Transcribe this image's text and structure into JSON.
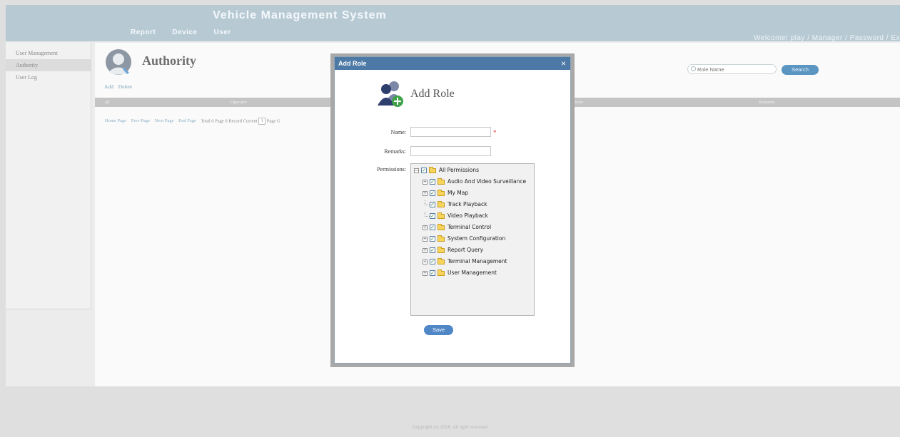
{
  "header": {
    "app_title": "Vehicle Management System",
    "nav": [
      "Report",
      "Device",
      "User"
    ],
    "welcome": "Welcome!",
    "user": "play",
    "role": "Manager",
    "password_link": "Password",
    "exit_link": "Ex",
    "separator": " / "
  },
  "sidebar": {
    "items": [
      {
        "label": "User Management"
      },
      {
        "label": "Authority"
      },
      {
        "label": "User Log"
      }
    ],
    "active": "Authority"
  },
  "page": {
    "title": "Authority",
    "actions": [
      "Add",
      "Delete"
    ],
    "search": {
      "placeholder": "Role Name",
      "button": "Search"
    }
  },
  "table": {
    "columns": [
      "all",
      "Operator",
      "Role",
      "Remarks"
    ]
  },
  "pager": {
    "home": "Home Page",
    "prev": "Prev Page",
    "next": "Next Page",
    "end": "End Page",
    "total_text": "Total 0 Page  0 Record  Current",
    "current_page": "1",
    "page_suffix": "Page",
    "go": "G"
  },
  "dialog": {
    "title": "Add Role",
    "heading": "Add Role",
    "close_symbol": "×",
    "fields": {
      "name_label": "Name:",
      "name_value": "",
      "required_mark": "*",
      "remarks_label": "Remarks:",
      "remarks_value": "",
      "permissions_label": "Permissions:"
    },
    "tree_root": {
      "label": "All Permissions",
      "checked": true,
      "expanded": true
    },
    "tree_items": [
      {
        "label": "Audio And Video Surveillance",
        "checked": true,
        "expandable": true
      },
      {
        "label": "My Map",
        "checked": true,
        "expandable": true
      },
      {
        "label": "Track Playback",
        "checked": true,
        "expandable": false
      },
      {
        "label": "Video Playback",
        "checked": true,
        "expandable": false
      },
      {
        "label": "Terminal Control",
        "checked": true,
        "expandable": true
      },
      {
        "label": "System Configuration",
        "checked": true,
        "expandable": true
      },
      {
        "label": "Report Query",
        "checked": true,
        "expandable": true
      },
      {
        "label": "Terminal Management",
        "checked": true,
        "expandable": true
      },
      {
        "label": "User Management",
        "checked": true,
        "expandable": true
      }
    ],
    "save_label": "Save"
  },
  "footer": {
    "copyright": "Copyright (c) 2016. All right reserved"
  },
  "icons": {
    "authority_icon": "user-silhouette-icon",
    "role_icon": "add-user-group-icon",
    "search_icon": "magnifier-icon",
    "folder_icon": "folder-icon",
    "checkbox_icon": "checkbox-checked-icon"
  },
  "colors": {
    "header_bg": "#b7cad4",
    "dialog_title_bg": "#4d79a6",
    "button_blue": "#4f86c6",
    "folder_yellow": "#f7d45c",
    "required_red": "#ee3333"
  }
}
